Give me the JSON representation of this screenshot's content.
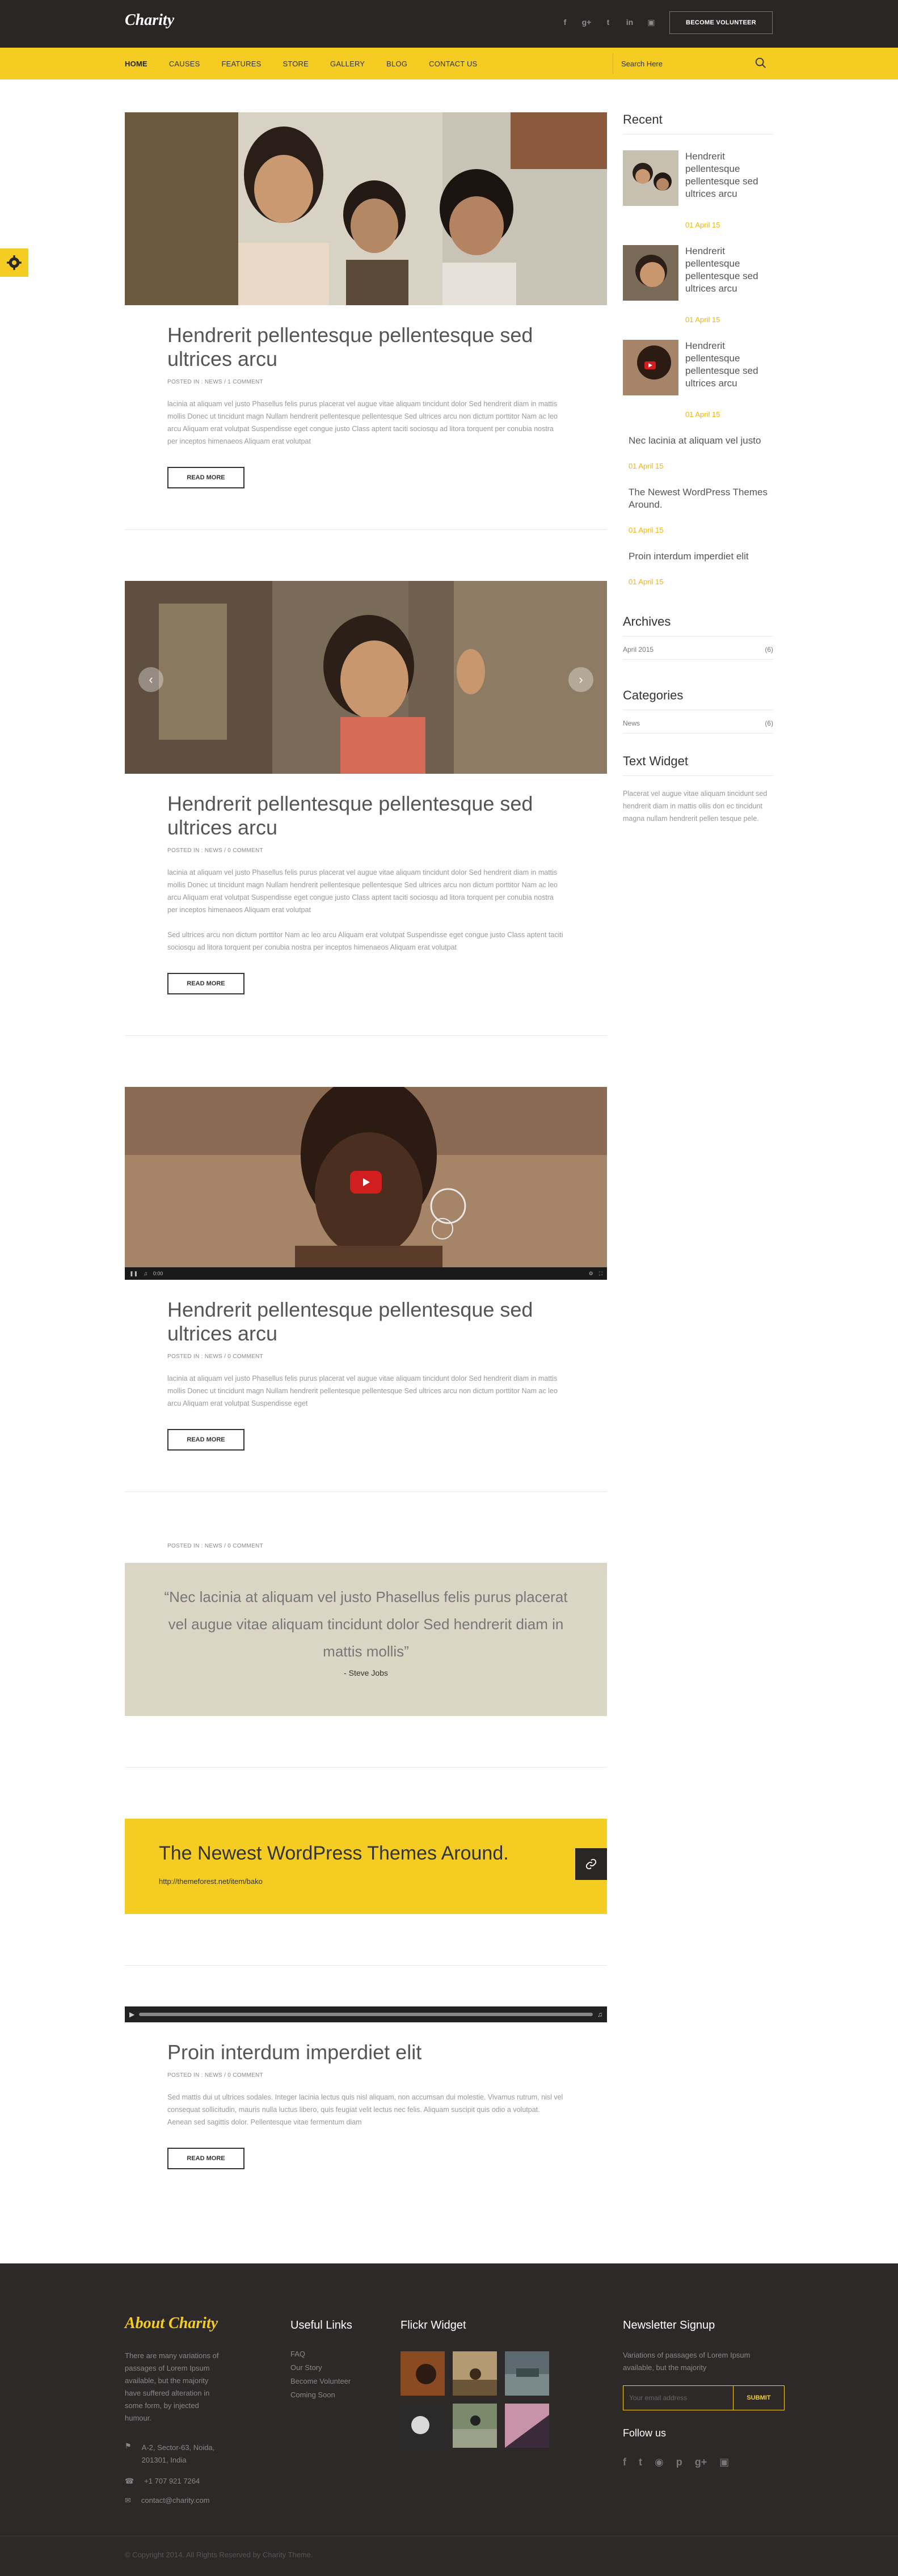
{
  "header": {
    "logo": "Charity",
    "volunteer": "BECOME VOLUNTEER",
    "socials": [
      "facebook-icon",
      "google-plus-icon",
      "twitter-icon",
      "linkedin-icon",
      "instagram-icon"
    ]
  },
  "nav": {
    "items": [
      "HOME",
      "CAUSES",
      "FEATURES",
      "STORE",
      "GALLERY",
      "BLOG",
      "CONTACT US"
    ],
    "search_placeholder": "Search Here"
  },
  "posts": [
    {
      "title": "Hendrerit pellentesque pellentesque sed ultrices arcu",
      "meta": "POSTED IN : NEWS  /  1 COMMENT",
      "text": "lacinia at aliquam vel justo Phasellus felis purus placerat vel augue vitae aliquam tincidunt dolor Sed hendrerit diam in mattis mollis Donec ut tincidunt magn Nullam hendrerit pellentesque pellentesque Sed ultrices arcu non dictum porttitor Nam ac leo arcu Aliquam erat volutpat Suspendisse eget congue justo Class aptent taciti sociosqu ad litora torquent per conubia nostra per inceptos himenaeos Aliquam erat volutpat",
      "button": "READ MORE"
    },
    {
      "title": "Hendrerit pellentesque pellentesque sed ultrices arcu",
      "meta": "POSTED IN : NEWS  /  0 COMMENT",
      "text": "lacinia at aliquam vel justo Phasellus felis purus placerat vel augue vitae aliquam tincidunt dolor Sed hendrerit diam in mattis mollis Donec ut tincidunt magn Nullam hendrerit pellentesque pellentesque Sed ultrices arcu non dictum porttitor Nam ac leo arcu Aliquam erat volutpat Suspendisse eget congue justo Class aptent taciti sociosqu ad litora torquent per conubia nostra per inceptos himenaeos Aliquam erat volutpat",
      "text2": "Sed ultrices arcu non dictum porttitor Nam ac leo arcu Aliquam erat volutpat Suspendisse eget congue justo Class aptent taciti sociosqu ad litora torquent per conubia nostra per inceptos himenaeos Aliquam erat volutpat",
      "button": "READ MORE"
    },
    {
      "title": "Hendrerit pellentesque pellentesque sed ultrices arcu",
      "meta": "POSTED IN : NEWS  /  0 COMMENT",
      "text": "lacinia at aliquam vel justo Phasellus felis purus placerat vel augue vitae aliquam tincidunt dolor Sed hendrerit diam in mattis mollis Donec ut tincidunt magn Nullam hendrerit pellentesque pellentesque Sed ultrices arcu non dictum porttitor Nam ac leo arcu Aliquam erat volutpat Suspendisse eget",
      "button": "READ MORE",
      "video_time": "0:00"
    }
  ],
  "quote_post": {
    "meta": "POSTED IN : NEWS  /  0 COMMENT",
    "quote": "“Nec lacinia at aliquam vel justo Phasellus felis purus placerat vel augue vitae aliquam tincidunt dolor Sed hendrerit diam in mattis mollis”",
    "author": "- Steve Jobs"
  },
  "link_post": {
    "title": "The Newest WordPress Themes Around.",
    "url": "http://themeforest.net/item/bako"
  },
  "audio_post": {
    "title": "Proin interdum imperdiet elit",
    "meta": "POSTED IN : NEWS  /  0 COMMENT",
    "text": "Sed mattis dui ut ultrices sodales. Integer lacinia lectus quis nisl aliquam, non accumsan dui molestie. Vivamus rutrum, nisl vel consequat sollicitudin, mauris nulla luctus libero, quis feugiat velit lectus nec felis. Aliquam suscipit quis odio a volutpat. Aenean sed sagittis dolor. Pellentesque vitae fermentum diam",
    "button": "READ MORE"
  },
  "sidebar": {
    "recent_title": "Recent",
    "recent": [
      {
        "title": "Hendrerit pellentesque pellentesque sed ultrices arcu",
        "date": "01 April 15"
      },
      {
        "title": "Hendrerit pellentesque pellentesque sed ultrices arcu",
        "date": "01 April 15"
      },
      {
        "title": "Hendrerit pellentesque pellentesque sed ultrices arcu",
        "date": "01 April 15"
      }
    ],
    "recent_text": [
      {
        "title": "Nec lacinia at aliquam vel justo",
        "date": "01 April 15"
      },
      {
        "title": "The Newest WordPress Themes Around.",
        "date": "01 April 15"
      },
      {
        "title": "Proin interdum imperdiet elit",
        "date": "01 April 15"
      }
    ],
    "archives_title": "Archives",
    "archive_item": "April 2015",
    "archive_count": "(6)",
    "categories_title": "Categories",
    "category_item": "News",
    "category_count": "(6)",
    "text_widget_title": "Text Widget",
    "text_widget": "Placerat vel augue vitae aliquam tincidunt sed hendrerit diam in mattis ollis don ec tincidunt magna nullam hendrerit pellen tesque pele."
  },
  "footer": {
    "about_title": "About Charity",
    "about_text": "There are many variations of passages of Lorem Ipsum available, but the majority have suffered alteration in some form, by injected humour.",
    "address": "A-2, Sector-63, Noida, 201301, India",
    "phone": "+1 707 921 7264",
    "email": "contact@charity.com",
    "links_title": "Useful Links",
    "links": [
      "FAQ",
      "Our Story",
      "Become Volunteer",
      "Coming Soon"
    ],
    "flickr_title": "Flickr Widget",
    "news_title": "Newsletter Signup",
    "news_text": "Variations of passages of Lorem Ipsum available, but the majority",
    "news_placeholder": "Your email address",
    "news_button": "SUBMIT",
    "follow_title": "Follow us",
    "copyright": "© Copyright 2014. All Rights Reserved by Charity Theme."
  },
  "colors": {
    "accent": "#f5cc21",
    "dark": "#2b2626",
    "date": "#f5b400"
  }
}
